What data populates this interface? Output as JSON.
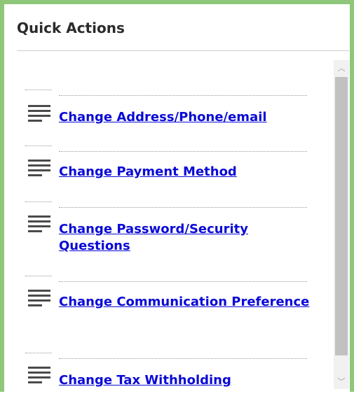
{
  "panel": {
    "title": "Quick Actions"
  },
  "actions": [
    {
      "label": "Change Address/Phone/email",
      "icon": "menu-lines-icon"
    },
    {
      "label": "Change Payment Method",
      "icon": "menu-lines-icon"
    },
    {
      "label": "Change Password/Security Questions",
      "icon": "menu-lines-icon"
    },
    {
      "label": "Change Communication Preference",
      "icon": "menu-lines-icon"
    },
    {
      "label": "Change Tax Withholding",
      "icon": "menu-lines-icon"
    }
  ],
  "scrollbar": {
    "up_glyph": "︿",
    "down_glyph": "﹀"
  },
  "colors": {
    "panel_border": "#8fc77a",
    "link": "#0a0ad6",
    "icon": "#4a4a4a"
  }
}
